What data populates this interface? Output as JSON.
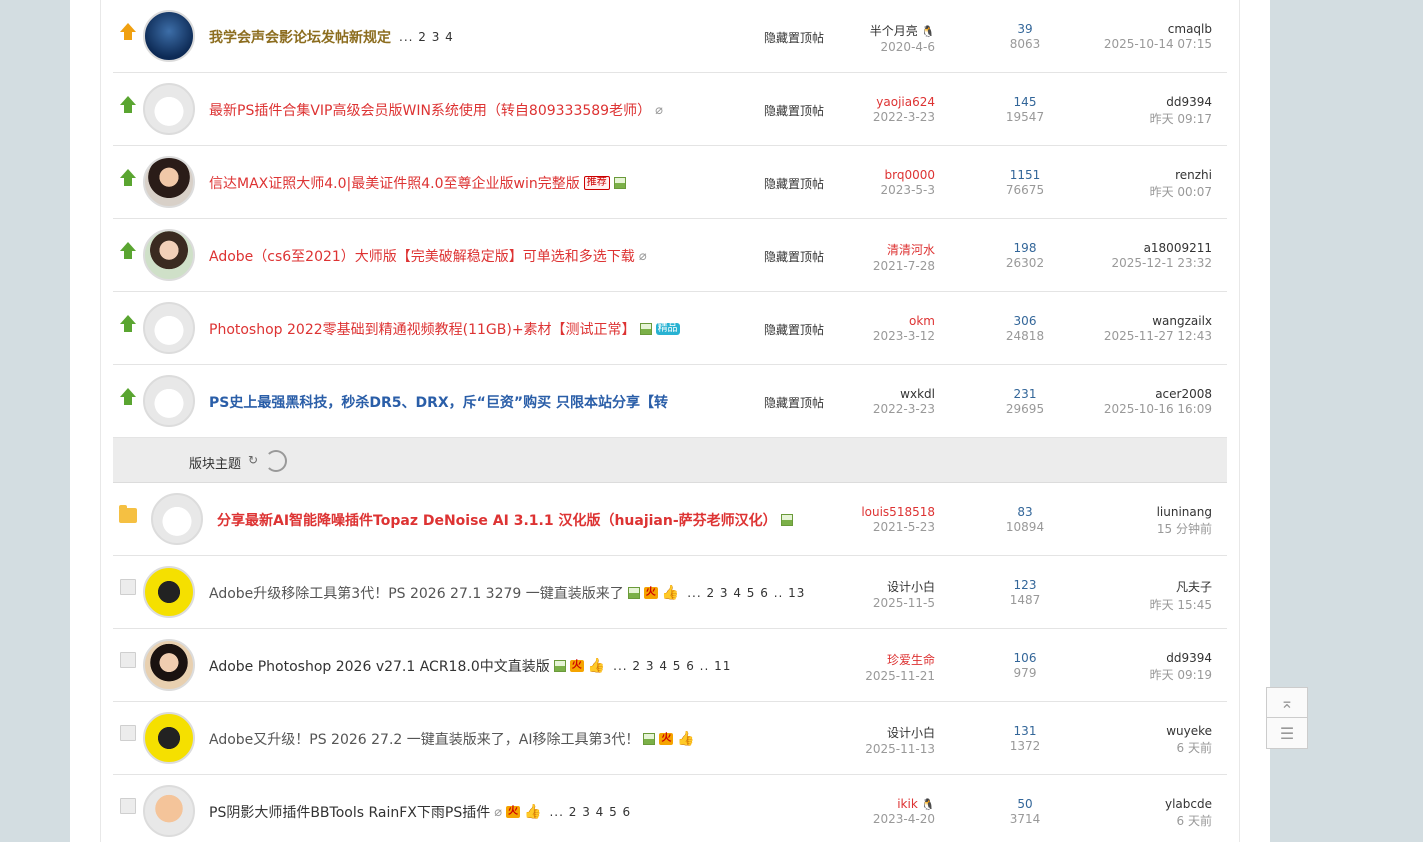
{
  "threads_top": [
    {
      "icon": "orange-up",
      "title": "我学会声会影论坛发帖新规定",
      "title_color": "#8c6d1f",
      "bold": true,
      "pages": "... 2 3 4",
      "extras": [],
      "mod": "隐藏置顶帖",
      "author": "半个月亮",
      "author_color": "#333",
      "author_icon": "qq-penguin-icon",
      "date": "2020-4-6",
      "replies": "39",
      "views": "8063",
      "last_user": "cmaqlb",
      "last_time": "2025-10-14 07:15",
      "avatar": "moon"
    },
    {
      "icon": "green-up",
      "title": "最新PS插件合集VIP高级会员版WIN系统使用（转自809333589老师）",
      "title_color": "#d33",
      "bold": false,
      "pages": "",
      "extras": [
        "clip"
      ],
      "mod": "隐藏置顶帖",
      "author": "yaojia624",
      "author_color": "#d33",
      "author_icon": "",
      "date": "2022-3-23",
      "replies": "145",
      "views": "19547",
      "last_user": "dd9394",
      "last_time": "昨天 09:17",
      "avatar": "cartoon"
    },
    {
      "icon": "green-up",
      "title": "信达MAX证照大师4.0|最美证件照4.0至尊企业版win完整版",
      "title_color": "#d33",
      "bold": false,
      "pages": "",
      "extras": [
        "rec",
        "img"
      ],
      "mod": "隐藏置顶帖",
      "author": "brq0000",
      "author_color": "#d33",
      "author_icon": "",
      "date": "2023-5-3",
      "replies": "1151",
      "views": "76675",
      "last_user": "renzhi",
      "last_time": "昨天 00:07",
      "avatar": "woman1"
    },
    {
      "icon": "green-up",
      "title": "Adobe（cs6至2021）大师版【完美破解稳定版】可单选和多选下载",
      "title_color": "#d33",
      "bold": false,
      "pages": "",
      "extras": [
        "clip"
      ],
      "mod": "隐藏置顶帖",
      "author": "清清河水",
      "author_color": "#d33",
      "author_icon": "",
      "date": "2021-7-28",
      "replies": "198",
      "views": "26302",
      "last_user": "a18009211",
      "last_time": "2025-12-1 23:32",
      "avatar": "woman2"
    },
    {
      "icon": "green-up",
      "title": "Photoshop 2022零基础到精通视频教程(11GB)+素材【测试正常】",
      "title_color": "#d33",
      "bold": false,
      "pages": "",
      "extras": [
        "img",
        "jing"
      ],
      "mod": "隐藏置顶帖",
      "author": "okm",
      "author_color": "#d33",
      "author_icon": "",
      "date": "2023-3-12",
      "replies": "306",
      "views": "24818",
      "last_user": "wangzailx",
      "last_time": "2025-11-27 12:43",
      "avatar": "cartoon"
    },
    {
      "icon": "green-up",
      "title": "PS史上最强黑科技，秒杀DR5、DRX，斥“巨资”购买 只限本站分享【转",
      "title_color": "#2a5ea8",
      "bold": true,
      "pages": "",
      "extras": [],
      "mod": "隐藏置顶帖",
      "author": "wxkdl",
      "author_color": "#333",
      "author_icon": "",
      "date": "2022-3-23",
      "replies": "231",
      "views": "29695",
      "last_user": "acer2008",
      "last_time": "2025-10-16 16:09",
      "avatar": "cartoon"
    }
  ],
  "section": {
    "label": "版块主题",
    "refresh_glyph": "↻"
  },
  "threads_bottom": [
    {
      "icon": "folder",
      "title": "分享最新AI智能降噪插件Topaz DeNoise AI 3.1.1 汉化版（huajian-萨芬老师汉化）",
      "title_color": "#d33",
      "bold": true,
      "pages": "",
      "extras": [
        "img"
      ],
      "author": "louis518518",
      "author_color": "#d33",
      "author_icon": "",
      "date": "2021-5-23",
      "replies": "83",
      "views": "10894",
      "last_user": "liuninang",
      "last_time": "15 分钟前",
      "avatar": "cartoon"
    },
    {
      "icon": "doc",
      "title": "Adobe升级移除工具第3代！PS 2026 27.1 3279 一键直装版来了",
      "title_color": "#555",
      "bold": false,
      "pages": "... 2 3 4 5 6 .. 13",
      "extras": [
        "img",
        "hot",
        "thumb"
      ],
      "author": "设计小白",
      "author_color": "#333",
      "author_icon": "",
      "date": "2025-11-5",
      "replies": "123",
      "views": "1487",
      "last_user": "凡夫子",
      "last_time": "昨天 15:45",
      "avatar": "yellow"
    },
    {
      "icon": "doc",
      "title": "Adobe Photoshop 2026 v27.1 ACR18.0中文直装版",
      "title_color": "#333",
      "bold": false,
      "pages": "... 2 3 4 5 6 .. 11",
      "extras": [
        "img",
        "hot",
        "thumb"
      ],
      "author": "珍爱生命",
      "author_color": "#d33",
      "author_icon": "",
      "date": "2025-11-21",
      "replies": "106",
      "views": "979",
      "last_user": "dd9394",
      "last_time": "昨天 09:19",
      "avatar": "woman3"
    },
    {
      "icon": "doc",
      "title": "Adobe又升级！PS 2026 27.2 一键直装版来了，AI移除工具第3代！",
      "title_color": "#555",
      "bold": false,
      "pages": "",
      "extras": [
        "img",
        "hot",
        "thumb"
      ],
      "author": "设计小白",
      "author_color": "#333",
      "author_icon": "",
      "date": "2025-11-13",
      "replies": "131",
      "views": "1372",
      "last_user": "wuyeke",
      "last_time": "6 天前",
      "avatar": "yellow"
    },
    {
      "icon": "doc",
      "title": "PS阴影大师插件BBTools RainFX下雨PS插件",
      "title_color": "#333",
      "bold": false,
      "pages": "... 2 3 4 5 6",
      "extras": [
        "clip",
        "hot",
        "thumb"
      ],
      "author": "ikik",
      "author_color": "#d33",
      "author_icon": "qq-penguin-icon",
      "date": "2023-4-20",
      "replies": "50",
      "views": "3714",
      "last_user": "ylabcde",
      "last_time": "6 天前",
      "avatar": "monk"
    }
  ],
  "tags": {
    "rec": "推荐",
    "jing": "精品",
    "hot": "火"
  },
  "side_tools": {
    "top_glyph": "⌅",
    "list_glyph": "☰"
  }
}
